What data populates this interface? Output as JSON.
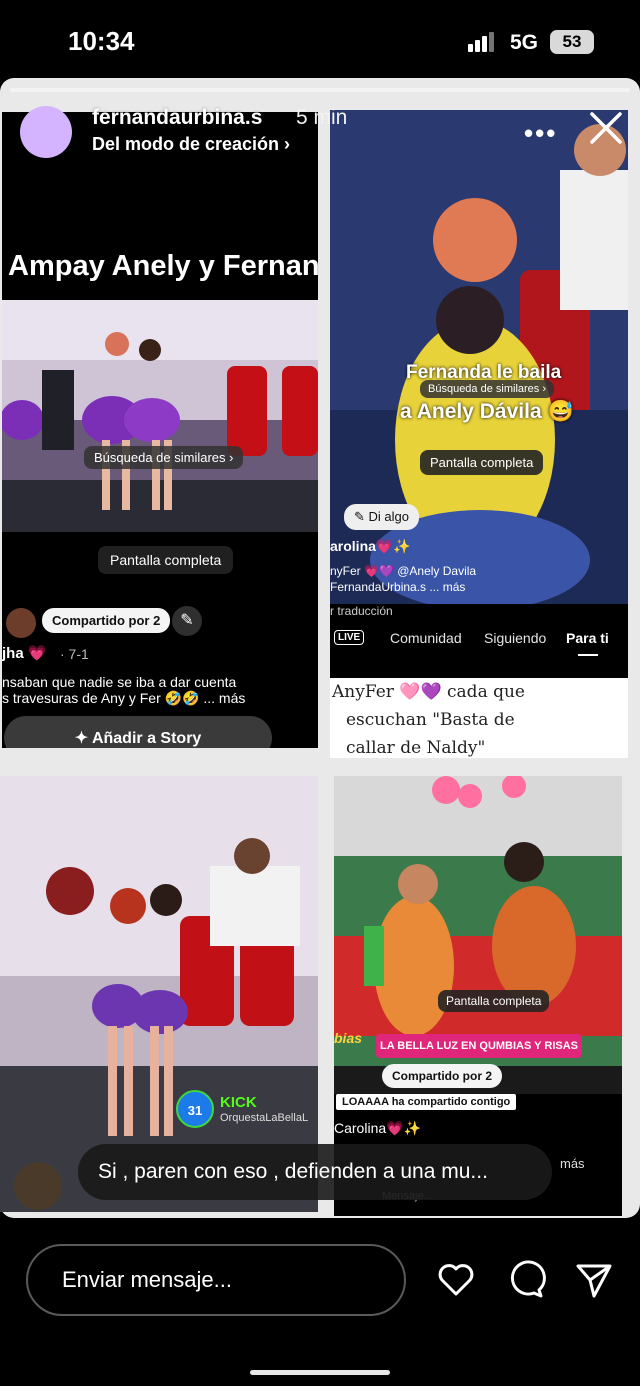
{
  "status": {
    "time": "10:34",
    "network": "5G",
    "battery": "53"
  },
  "header": {
    "username": "fernandaurbina.s",
    "time_ago": "5 min",
    "subtitle": "Del modo de creación ›",
    "more_icon": "more-horizontal-icon",
    "close_icon": "close-icon"
  },
  "tile_tl": {
    "title": "Ampay Anely y Fernanda",
    "similar": "Búsqueda de similares ›",
    "fullscreen": "Pantalla completa",
    "shared_by": "Compartido por 2",
    "username": "jha 💗",
    "date": "· 7-1",
    "caption_line1": "nsaban que nadie se iba a dar cuenta",
    "caption_line2": "s travesuras de Any y Fer 🤣🤣 ... más",
    "add_story": "Añadir a Story"
  },
  "tile_tr": {
    "overlay_line1": "Fernanda le baila",
    "similar": "Búsqueda de similares ›",
    "overlay_line2": "a Anely Dávila 😅",
    "fullscreen": "Pantalla completa",
    "say_something": "Di algo",
    "user1": "arolina💗✨",
    "user2": "nyFer 💗💜 @Anely Davila",
    "user3": "FernandaUrbina.s ... más",
    "translation": "r traducción",
    "live": "LIVE",
    "tabs": [
      "Comunidad",
      "Siguiendo",
      "Para ti"
    ],
    "caption_line1": "AnyFer 🩷💜 cada que",
    "caption_line2": "escuchan \"Basta de",
    "caption_line3": "callar de Naldy\""
  },
  "tile_bl": {
    "kick_badge": "31",
    "kick_label": "KICK",
    "kick_channel": "OrquestaLaBellaL"
  },
  "tile_br": {
    "fullscreen": "Pantalla completa",
    "banner": "LA BELLA LUZ EN QUMBIAS Y RISAS",
    "banner_tag": "bias",
    "shared_by": "Compartido por 2",
    "notice": "LOAAAA ha compartido contigo",
    "user": "Carolina💗✨",
    "more": "más",
    "message_placeholder": "Mensaje..."
  },
  "reply_bubble": "Si , paren con eso , defienden a una mu...",
  "bottom": {
    "placeholder": "Enviar mensaje...",
    "like_icon": "heart-icon",
    "comment_icon": "comment-icon",
    "share_icon": "send-icon"
  }
}
